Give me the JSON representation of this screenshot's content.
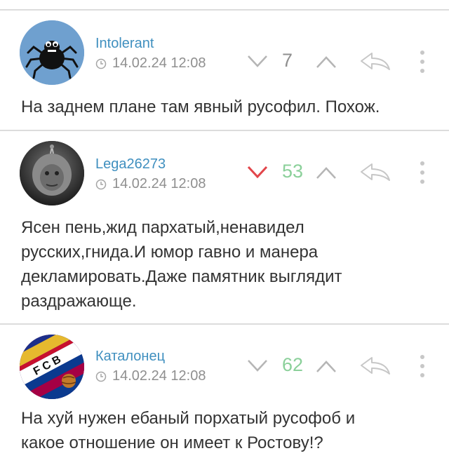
{
  "comments": [
    {
      "author": "Intolerant",
      "timestamp": "14.02.24 12:08",
      "score": "7",
      "score_color": "#8f8f8f",
      "vote_down_color": "#b5b5b5",
      "avatar_icon": "spider-avatar",
      "text": "На заднем плане там явный русофил. Похож."
    },
    {
      "author": "Lega26273",
      "timestamp": "14.02.24 12:08",
      "score": "53",
      "score_color": "#8bd09a",
      "vote_down_color": "#e2454a",
      "avatar_icon": "teletubby-avatar",
      "text_lines": [
        "Ясен пень,жид пархатый,ненавидел",
        "русских,гнида.И юмор гавно и манера",
        "декламировать.Даже памятник выглядит",
        "раздражающе."
      ]
    },
    {
      "author": "Каталонец",
      "timestamp": "14.02.24 12:08",
      "score": "62",
      "score_color": "#8bd09a",
      "vote_down_color": "#b5b5b5",
      "avatar_icon": "fcb-badge-avatar",
      "text_lines": [
        "На хуй нужен ебаный порхатый русофоб и",
        "какое отношение он имеет к Ростову!?"
      ]
    }
  ],
  "icons": {
    "clock": "clock-icon",
    "vote_down": "chevron-down-icon",
    "vote_up": "chevron-up-icon",
    "reply": "reply-arrow-icon",
    "more": "more-vertical-icon"
  },
  "colors": {
    "author": "#3f8fbf",
    "muted": "#8f8f8f",
    "divider": "#dcdcdc",
    "icon_light": "#c7c7c7"
  }
}
